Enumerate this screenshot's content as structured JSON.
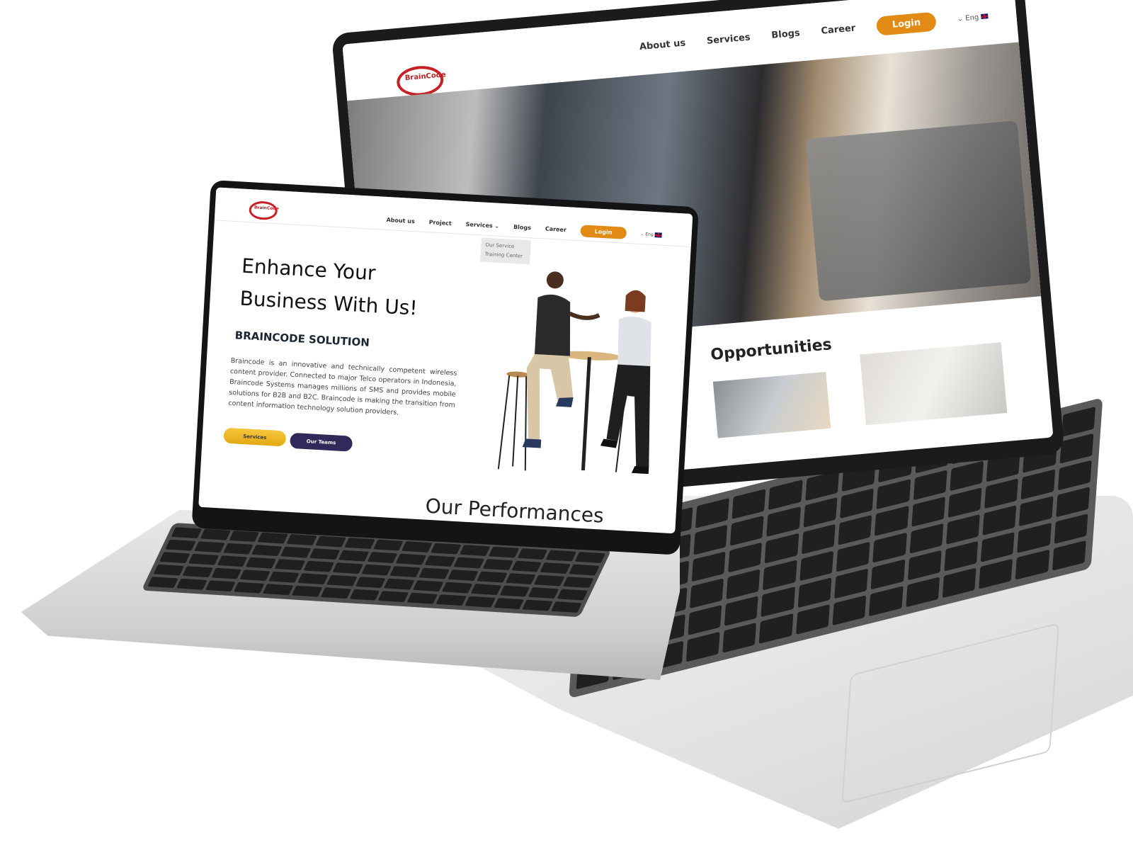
{
  "back_site": {
    "logo_text": "BrainCode",
    "nav": {
      "about": "About us",
      "services": "Services",
      "blogs": "Blogs",
      "career": "Career",
      "login": "Login",
      "lang": "⌄ Eng"
    },
    "section_title": "Opportunities"
  },
  "front_site": {
    "logo_text": "BrainCode",
    "nav": {
      "about": "About us",
      "project": "Project",
      "services": "Services ⌄",
      "blogs": "Blogs",
      "career": "Career",
      "login": "Login",
      "lang": "⌄ Eng"
    },
    "services_dropdown": [
      "Our Service",
      "Training Center"
    ],
    "hero": {
      "line1": "Enhance Your",
      "line2": "Business With Us!",
      "subtitle": "BRAINCODE SOLUTION",
      "body": "Braincode is an innovative and technically competent wireless content provider. Connected to major Telco operators in Indonesia, Braincode Systems manages millions of SMS and provides mobile solutions for B2B and B2C. Braincode is making the transition from content information technology solution providers.",
      "btn_services": "Services",
      "btn_teams": "Our Teams"
    },
    "performance_title": "Our Performances"
  },
  "colors": {
    "accent_orange": "#e28b14",
    "yellow_button": "#f2bb2c",
    "navy_button": "#2f2a5a",
    "brand_red": "#c61f24"
  }
}
